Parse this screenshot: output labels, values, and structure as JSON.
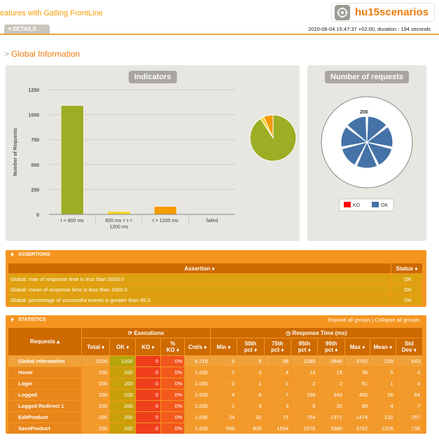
{
  "header": {
    "top_link": "eatures with Gatling FrontLine",
    "logo_text": "hu15scenarios",
    "details_tab": "▾ DETAILS",
    "run_info": "2020-06-04 15:47:37 +02:00, duration : 194 seconds"
  },
  "section_title": "Global Information",
  "indicators": {
    "title": "Indicators",
    "chart_data": {
      "type": "bar",
      "categories": [
        "t < 800 ms",
        "800 ms < t < 1200 ms",
        "t > 1200 ms",
        "failed"
      ],
      "values": [
        1090,
        30,
        80,
        0
      ],
      "ylabel": "Number of Requests",
      "ylim": [
        0,
        1250
      ],
      "yticks": [
        0,
        250,
        500,
        750,
        1000,
        1250
      ],
      "colors": [
        "#9bae24",
        "#f6d42f",
        "#f59b00",
        "#e03a1c"
      ],
      "pie": {
        "values": [
          1090,
          30,
          80,
          0
        ]
      }
    }
  },
  "requests": {
    "title": "Number of requests",
    "center_label": "200",
    "legend": [
      {
        "label": "KO",
        "color": "#ff0000"
      },
      {
        "label": "OK",
        "color": "#4572a7"
      }
    ]
  },
  "assertions": {
    "header": "ASSERTIONS",
    "col_assertion": "Assertion ♦",
    "col_status": "Status ♦",
    "rows": [
      {
        "text": "Global: max of response time is less than 5000.0",
        "status": "OK"
      },
      {
        "text": "Global: mean of response time is less than 1000.0",
        "status": "OK"
      },
      {
        "text": "Global: percentage of successful events is greater than 95.0",
        "status": "OK"
      }
    ]
  },
  "statistics": {
    "header": "STATISTICS",
    "expand_links": "Expand all groups | Collapse all groups",
    "group_requests": "Requests ▴",
    "group_executions": "Executions",
    "group_response": "Response Time (ms)",
    "cols": [
      "Total ♦",
      "OK ♦",
      "KO ♦",
      "% KO ♦",
      "Cnt/s ♦",
      "Min ♦",
      "50th pct ♦",
      "75th pct ♦",
      "95th pct ♦",
      "99th pct ♦",
      "Max ♦",
      "Mean ♦",
      "Std Dev ♦"
    ],
    "rows": [
      {
        "name": "Global Information",
        "v": [
          "1200",
          "1200",
          "0",
          "0%",
          "6.218",
          "0",
          "5",
          "38",
          "1385",
          "2840",
          "3762",
          "229",
          "543"
        ]
      },
      {
        "name": "Home",
        "v": [
          "200",
          "200",
          "0",
          "0%",
          "1.036",
          "2",
          "3",
          "4",
          "14",
          "19",
          "38",
          "5",
          "4"
        ]
      },
      {
        "name": "Login",
        "v": [
          "200",
          "200",
          "0",
          "0%",
          "1.036",
          "0",
          "1",
          "1",
          "2",
          "2",
          "61",
          "1",
          "4"
        ]
      },
      {
        "name": "Logged",
        "v": [
          "200",
          "200",
          "0",
          "0%",
          "1.036",
          "4",
          "6",
          "7",
          "166",
          "343",
          "400",
          "26",
          "64"
        ]
      },
      {
        "name": "Logged Redirect 1",
        "v": [
          "200",
          "200",
          "0",
          "0%",
          "1.036",
          "1",
          "3",
          "3",
          "8",
          "20",
          "89",
          "4",
          "7"
        ]
      },
      {
        "name": "EditProduct",
        "v": [
          "200",
          "200",
          "0",
          "0%",
          "1.036",
          "24",
          "32",
          "71",
          "764",
          "1371",
          "1474",
          "132",
          "257"
        ]
      },
      {
        "name": "SaveProduct",
        "v": [
          "200",
          "200",
          "0",
          "0%",
          "1.036",
          "568",
          "806",
          "1534",
          "2976",
          "3380",
          "3762",
          "1205",
          "736"
        ]
      }
    ]
  }
}
